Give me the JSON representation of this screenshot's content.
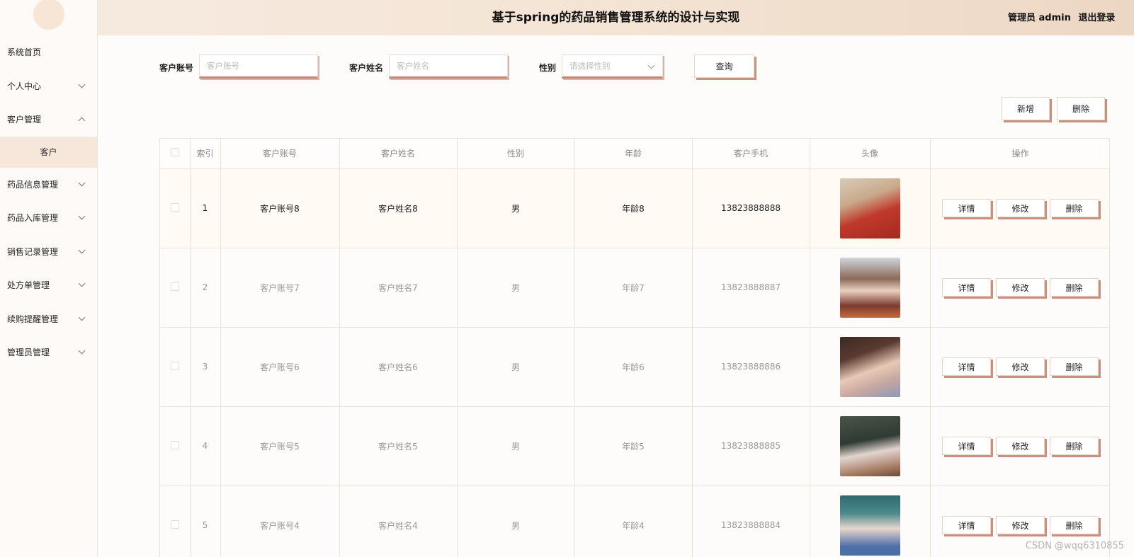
{
  "app": {
    "title": "基于spring的药品销售管理系统的设计与实现",
    "user_role": "管理员 admin",
    "logout": "退出登录"
  },
  "sidebar": {
    "items": [
      {
        "label": "系统首页",
        "icon": "none"
      },
      {
        "label": "个人中心",
        "icon": "chevron-down"
      },
      {
        "label": "客户管理",
        "icon": "chevron-up"
      },
      {
        "label": "药品信息管理",
        "icon": "chevron-down"
      },
      {
        "label": "药品入库管理",
        "icon": "chevron-down"
      },
      {
        "label": "销售记录管理",
        "icon": "chevron-down"
      },
      {
        "label": "处方单管理",
        "icon": "chevron-down"
      },
      {
        "label": "续购提醒管理",
        "icon": "chevron-down"
      },
      {
        "label": "管理员管理",
        "icon": "chevron-down"
      }
    ],
    "submenu_selected": "客户"
  },
  "search": {
    "account_label": "客户账号",
    "account_placeholder": "客户账号",
    "name_label": "客户姓名",
    "name_placeholder": "客户姓名",
    "gender_label": "性别",
    "gender_placeholder": "请选择性别",
    "query_button": "查询"
  },
  "actions": {
    "add": "新增",
    "delete": "删除"
  },
  "table": {
    "headers": [
      "索引",
      "客户账号",
      "客户姓名",
      "性别",
      "年龄",
      "客户手机",
      "头像",
      "操作"
    ],
    "op_labels": {
      "detail": "详情",
      "edit": "修改",
      "delete": "删除"
    },
    "rows": [
      {
        "index": "1",
        "account": "客户账号8",
        "name": "客户姓名8",
        "gender": "男",
        "age": "年龄8",
        "phone": "13823888888"
      },
      {
        "index": "2",
        "account": "客户账号7",
        "name": "客户姓名7",
        "gender": "男",
        "age": "年龄7",
        "phone": "13823888887"
      },
      {
        "index": "3",
        "account": "客户账号6",
        "name": "客户姓名6",
        "gender": "男",
        "age": "年龄6",
        "phone": "13823888886"
      },
      {
        "index": "4",
        "account": "客户账号5",
        "name": "客户姓名5",
        "gender": "男",
        "age": "年龄5",
        "phone": "13823888885"
      },
      {
        "index": "5",
        "account": "客户账号4",
        "name": "客户姓名4",
        "gender": "男",
        "age": "年龄4",
        "phone": "13823888884"
      }
    ]
  },
  "watermark": "CSDN @wqq6310855",
  "colors": {
    "accent": "#c9907e",
    "header_start": "#f6eadf",
    "header_end": "#ecd7c4",
    "submenu_bg": "#f7e7da"
  }
}
